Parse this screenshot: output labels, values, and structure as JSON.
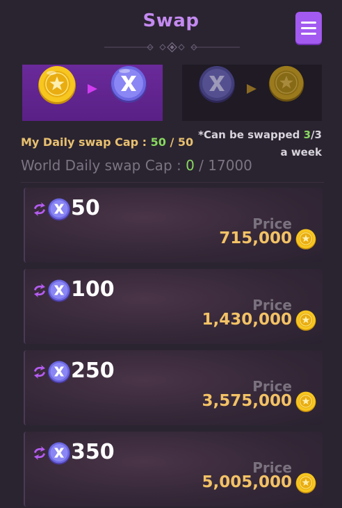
{
  "header": {
    "title": "Swap",
    "menu_icon": "hamburger-menu-icon"
  },
  "tabs": [
    {
      "from_icon": "gold-coin-icon",
      "to_icon": "x-token-icon",
      "active": true
    },
    {
      "from_icon": "x-token-icon",
      "to_icon": "gold-coin-icon",
      "active": false
    }
  ],
  "caps": {
    "my_label": "My Daily swap Cap : ",
    "my_used": "50",
    "my_sep": " / ",
    "my_total": "50",
    "world_label": "World Daily swap Cap : ",
    "world_used": "0",
    "world_sep": " / ",
    "world_total": "17000"
  },
  "note": {
    "prefix": "*Can be swapped ",
    "count": "3",
    "suffix": "/3 a week"
  },
  "items": [
    {
      "amount": "50",
      "price_label": "Price",
      "price": "715,000"
    },
    {
      "amount": "100",
      "price_label": "Price",
      "price": "1,430,000"
    },
    {
      "amount": "250",
      "price_label": "Price",
      "price": "3,575,000"
    },
    {
      "amount": "350",
      "price_label": "Price",
      "price": "5,005,000"
    }
  ],
  "colors": {
    "accent": "#c38af0",
    "menu": "#a25af0",
    "highlight_green": "#88d860",
    "price_gold": "#f3c266"
  }
}
